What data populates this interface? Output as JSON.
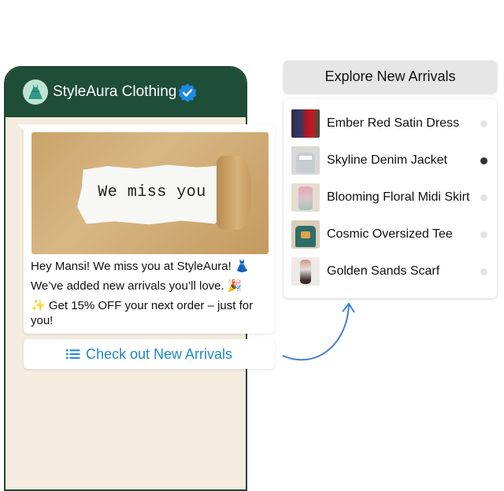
{
  "chat": {
    "business_name": "StyleAura Clothing",
    "avatar_icon": "dress-icon",
    "verified_icon": "verified-badge-icon"
  },
  "message": {
    "image_text": "We miss you",
    "line1": "Hey Mansi! We miss you at StyleAura! 👗",
    "line2": "We’ve added new arrivals you’ll love. 🎉",
    "line3": "✨ Get 15% OFF your next order – just for you!"
  },
  "cta": {
    "label": "Check out New Arrivals",
    "icon": "list-icon"
  },
  "arrivals": {
    "title": "Explore New Arrivals",
    "items": [
      {
        "label": "Ember Red Satin Dress",
        "selected": false
      },
      {
        "label": "Skyline Denim Jacket",
        "selected": true
      },
      {
        "label": "Blooming Floral Midi Skirt",
        "selected": false
      },
      {
        "label": "Cosmic Oversized Tee",
        "selected": false
      },
      {
        "label": "Golden Sands Scarf",
        "selected": false
      }
    ]
  },
  "colors": {
    "header_green": "#1e4d38",
    "chat_bg": "#f5ece0",
    "cta_blue": "#1e88c7",
    "verified_blue": "#1e88e5"
  }
}
